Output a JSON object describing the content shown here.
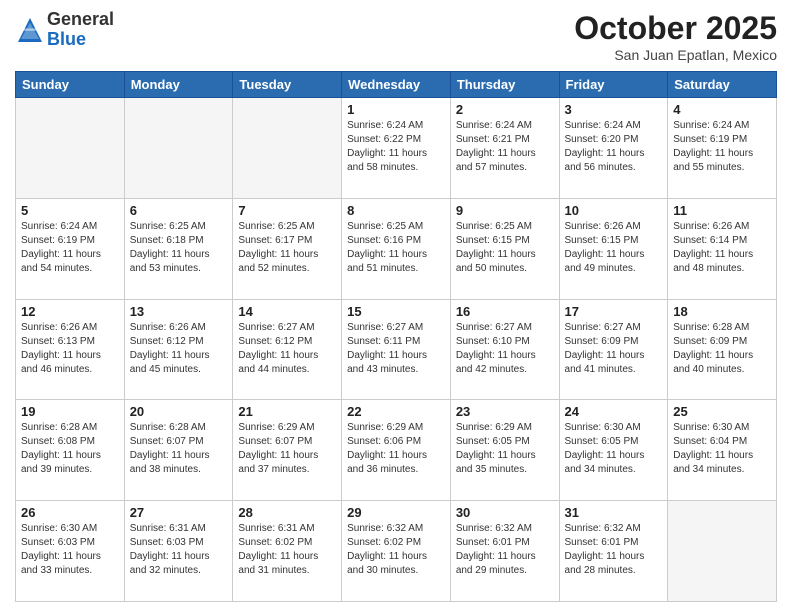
{
  "logo": {
    "general": "General",
    "blue": "Blue"
  },
  "title": "October 2025",
  "subtitle": "San Juan Epatlan, Mexico",
  "days_of_week": [
    "Sunday",
    "Monday",
    "Tuesday",
    "Wednesday",
    "Thursday",
    "Friday",
    "Saturday"
  ],
  "weeks": [
    [
      {
        "day": "",
        "info": ""
      },
      {
        "day": "",
        "info": ""
      },
      {
        "day": "",
        "info": ""
      },
      {
        "day": "1",
        "info": "Sunrise: 6:24 AM\nSunset: 6:22 PM\nDaylight: 11 hours\nand 58 minutes."
      },
      {
        "day": "2",
        "info": "Sunrise: 6:24 AM\nSunset: 6:21 PM\nDaylight: 11 hours\nand 57 minutes."
      },
      {
        "day": "3",
        "info": "Sunrise: 6:24 AM\nSunset: 6:20 PM\nDaylight: 11 hours\nand 56 minutes."
      },
      {
        "day": "4",
        "info": "Sunrise: 6:24 AM\nSunset: 6:19 PM\nDaylight: 11 hours\nand 55 minutes."
      }
    ],
    [
      {
        "day": "5",
        "info": "Sunrise: 6:24 AM\nSunset: 6:19 PM\nDaylight: 11 hours\nand 54 minutes."
      },
      {
        "day": "6",
        "info": "Sunrise: 6:25 AM\nSunset: 6:18 PM\nDaylight: 11 hours\nand 53 minutes."
      },
      {
        "day": "7",
        "info": "Sunrise: 6:25 AM\nSunset: 6:17 PM\nDaylight: 11 hours\nand 52 minutes."
      },
      {
        "day": "8",
        "info": "Sunrise: 6:25 AM\nSunset: 6:16 PM\nDaylight: 11 hours\nand 51 minutes."
      },
      {
        "day": "9",
        "info": "Sunrise: 6:25 AM\nSunset: 6:15 PM\nDaylight: 11 hours\nand 50 minutes."
      },
      {
        "day": "10",
        "info": "Sunrise: 6:26 AM\nSunset: 6:15 PM\nDaylight: 11 hours\nand 49 minutes."
      },
      {
        "day": "11",
        "info": "Sunrise: 6:26 AM\nSunset: 6:14 PM\nDaylight: 11 hours\nand 48 minutes."
      }
    ],
    [
      {
        "day": "12",
        "info": "Sunrise: 6:26 AM\nSunset: 6:13 PM\nDaylight: 11 hours\nand 46 minutes."
      },
      {
        "day": "13",
        "info": "Sunrise: 6:26 AM\nSunset: 6:12 PM\nDaylight: 11 hours\nand 45 minutes."
      },
      {
        "day": "14",
        "info": "Sunrise: 6:27 AM\nSunset: 6:12 PM\nDaylight: 11 hours\nand 44 minutes."
      },
      {
        "day": "15",
        "info": "Sunrise: 6:27 AM\nSunset: 6:11 PM\nDaylight: 11 hours\nand 43 minutes."
      },
      {
        "day": "16",
        "info": "Sunrise: 6:27 AM\nSunset: 6:10 PM\nDaylight: 11 hours\nand 42 minutes."
      },
      {
        "day": "17",
        "info": "Sunrise: 6:27 AM\nSunset: 6:09 PM\nDaylight: 11 hours\nand 41 minutes."
      },
      {
        "day": "18",
        "info": "Sunrise: 6:28 AM\nSunset: 6:09 PM\nDaylight: 11 hours\nand 40 minutes."
      }
    ],
    [
      {
        "day": "19",
        "info": "Sunrise: 6:28 AM\nSunset: 6:08 PM\nDaylight: 11 hours\nand 39 minutes."
      },
      {
        "day": "20",
        "info": "Sunrise: 6:28 AM\nSunset: 6:07 PM\nDaylight: 11 hours\nand 38 minutes."
      },
      {
        "day": "21",
        "info": "Sunrise: 6:29 AM\nSunset: 6:07 PM\nDaylight: 11 hours\nand 37 minutes."
      },
      {
        "day": "22",
        "info": "Sunrise: 6:29 AM\nSunset: 6:06 PM\nDaylight: 11 hours\nand 36 minutes."
      },
      {
        "day": "23",
        "info": "Sunrise: 6:29 AM\nSunset: 6:05 PM\nDaylight: 11 hours\nand 35 minutes."
      },
      {
        "day": "24",
        "info": "Sunrise: 6:30 AM\nSunset: 6:05 PM\nDaylight: 11 hours\nand 34 minutes."
      },
      {
        "day": "25",
        "info": "Sunrise: 6:30 AM\nSunset: 6:04 PM\nDaylight: 11 hours\nand 34 minutes."
      }
    ],
    [
      {
        "day": "26",
        "info": "Sunrise: 6:30 AM\nSunset: 6:03 PM\nDaylight: 11 hours\nand 33 minutes."
      },
      {
        "day": "27",
        "info": "Sunrise: 6:31 AM\nSunset: 6:03 PM\nDaylight: 11 hours\nand 32 minutes."
      },
      {
        "day": "28",
        "info": "Sunrise: 6:31 AM\nSunset: 6:02 PM\nDaylight: 11 hours\nand 31 minutes."
      },
      {
        "day": "29",
        "info": "Sunrise: 6:32 AM\nSunset: 6:02 PM\nDaylight: 11 hours\nand 30 minutes."
      },
      {
        "day": "30",
        "info": "Sunrise: 6:32 AM\nSunset: 6:01 PM\nDaylight: 11 hours\nand 29 minutes."
      },
      {
        "day": "31",
        "info": "Sunrise: 6:32 AM\nSunset: 6:01 PM\nDaylight: 11 hours\nand 28 minutes."
      },
      {
        "day": "",
        "info": ""
      }
    ]
  ]
}
